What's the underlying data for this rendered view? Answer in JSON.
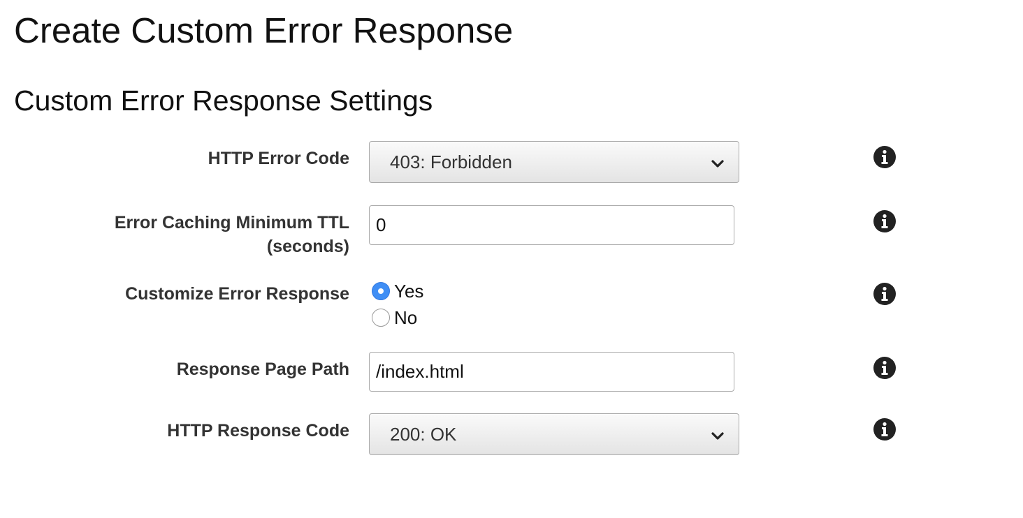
{
  "page_title": "Create Custom Error Response",
  "section_title": "Custom Error Response Settings",
  "fields": {
    "http_error_code": {
      "label": "HTTP Error Code",
      "value": "403: Forbidden",
      "icon": "info-icon"
    },
    "error_caching_ttl": {
      "label_line1": "Error Caching Minimum TTL",
      "label_line2": "(seconds)",
      "value": "0",
      "icon": "info-icon"
    },
    "customize_error_response": {
      "label": "Customize Error Response",
      "options": [
        {
          "label": "Yes",
          "selected": true
        },
        {
          "label": "No",
          "selected": false
        }
      ],
      "icon": "info-icon"
    },
    "response_page_path": {
      "label": "Response Page Path",
      "value": "/index.html",
      "icon": "info-icon"
    },
    "http_response_code": {
      "label": "HTTP Response Code",
      "value": "200: OK",
      "icon": "info-icon"
    }
  },
  "colors": {
    "radio_selected": "#3f8ef5",
    "label_text": "#333333",
    "info_icon": "#222222"
  }
}
